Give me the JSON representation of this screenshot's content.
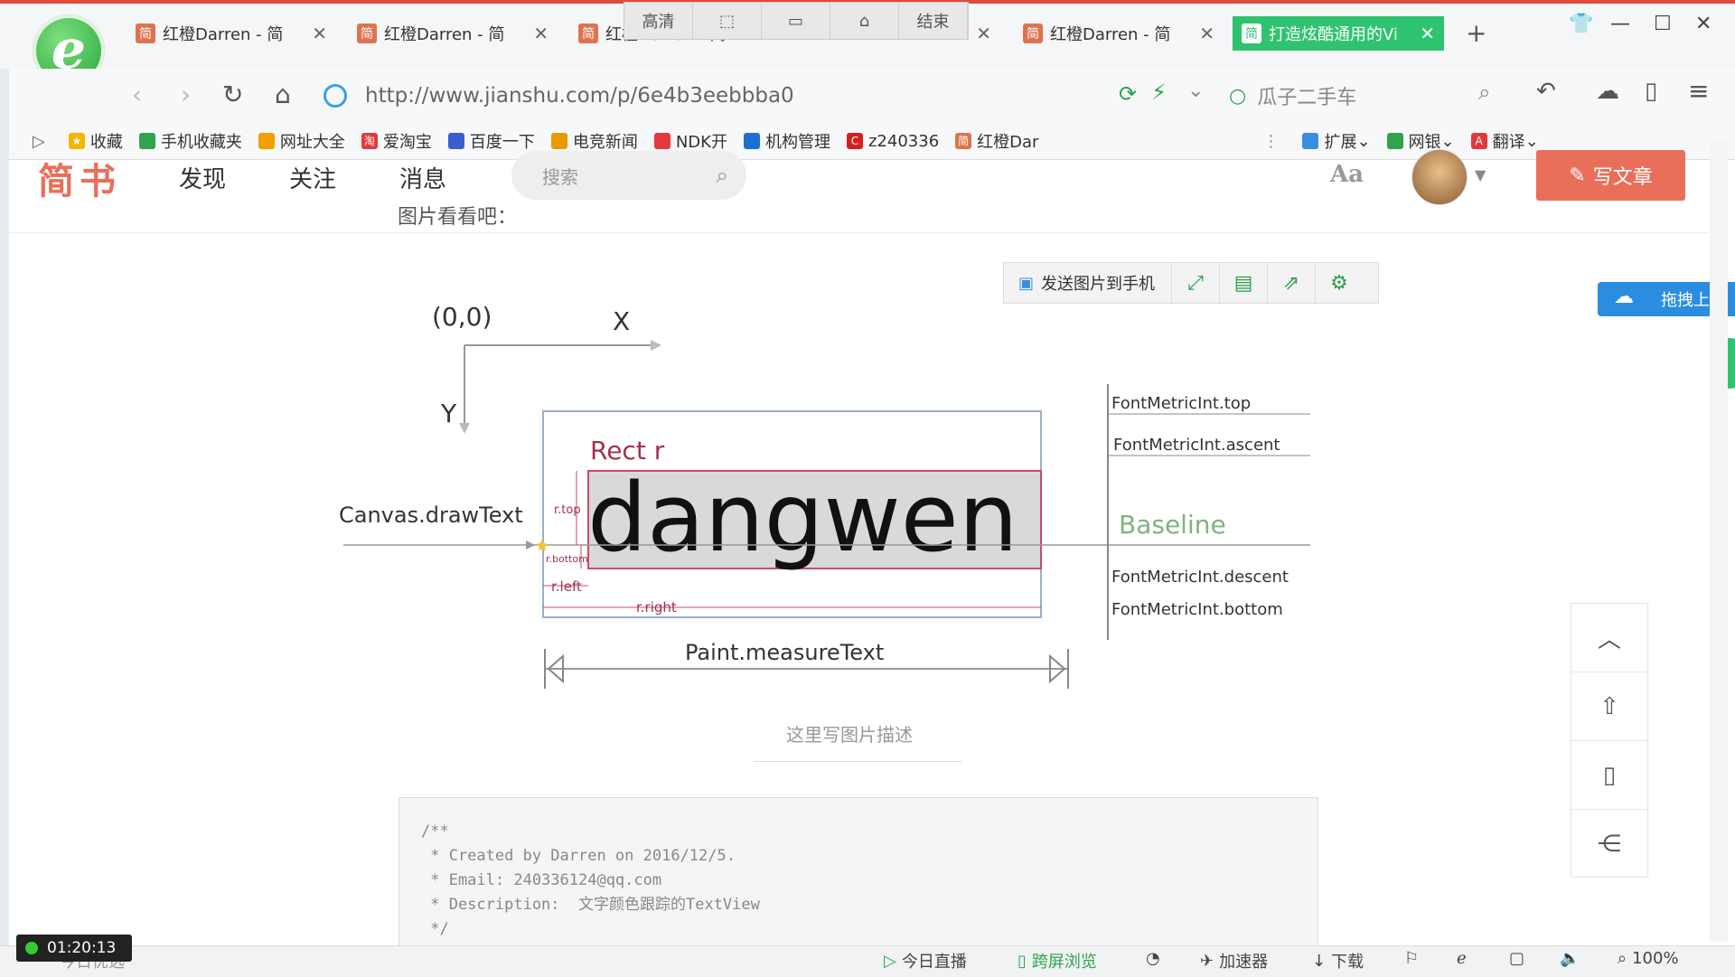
{
  "browser": {
    "tabs": [
      {
        "label": "红橙Darren - 简",
        "active": false
      },
      {
        "label": "红橙Darren - 简",
        "active": false
      },
      {
        "label": "红橙Darren - 简",
        "active": false
      },
      {
        "label": "",
        "active": false
      },
      {
        "label": "红橙Darren - 简",
        "active": false
      },
      {
        "label": "打造炫酷通用的Vi",
        "active": true
      }
    ],
    "tab_favicon": "简",
    "new_tab": "+",
    "recorder_bar": [
      "高清",
      "",
      "",
      "",
      "结束"
    ],
    "url": "http://www.jianshu.com/p/6e4b3eebbba0",
    "search_placeholder": "瓜子二手车",
    "bookmarks": [
      {
        "label": "收藏",
        "color": "#f5b400"
      },
      {
        "label": "手机收藏夹",
        "color": "#2ea44f"
      },
      {
        "label": "网址大全",
        "color": "#f0a000"
      },
      {
        "label": "爱淘宝",
        "color": "#e4393c"
      },
      {
        "label": "百度一下",
        "color": "#3a5fcd"
      },
      {
        "label": "电竞新闻",
        "color": "#e89a00"
      },
      {
        "label": "NDK开",
        "color": "#e4393c"
      },
      {
        "label": "机构管理",
        "color": "#1f6fd1"
      },
      {
        "label": "z240336",
        "color": "#d62020"
      },
      {
        "label": "红橙Dar",
        "color": "#e0734f"
      }
    ],
    "bookmark_right": [
      "扩展",
      "网银",
      "翻译"
    ]
  },
  "site": {
    "brand": "简书",
    "nav": [
      "发现",
      "关注",
      "消息"
    ],
    "search_placeholder": "搜索",
    "aa": "Aa",
    "write_button": "写文章",
    "partial_text": "图片看看吧："
  },
  "image_toolbar": {
    "send_label": "发送图片到手机"
  },
  "cloud_upload": "拖拽上传",
  "diagram": {
    "origin": "(0,0)",
    "x_axis": "X",
    "y_axis": "Y",
    "rect_label": "Rect r",
    "word": "dangwen",
    "draw_text_label": "Canvas.drawText",
    "rtop": "r.top",
    "rbottom": "r.bottom",
    "rleft": "r.left",
    "rright": "r.right",
    "baseline": "Baseline",
    "metrics": {
      "top": "FontMetricInt.top",
      "ascent": "FontMetricInt.ascent",
      "descent": "FontMetricInt.descent",
      "bottom": "FontMetricInt.bottom"
    },
    "measure": "Paint.measureText"
  },
  "caption": "这里写图片描述",
  "code_lines": [
    "/**",
    " * Created by Darren on 2016/12/5.",
    " * Email: 240336124@qq.com",
    " * Description:  文字颜色跟踪的TextView",
    " */"
  ],
  "status": {
    "timer": "01:20:13",
    "live": "今日直播",
    "cross": "跨屏浏览",
    "accel": "加速器",
    "download": "下载",
    "zoom": "100%",
    "left_text": "今日优选"
  },
  "colors": {
    "brand": "#ea6f5a",
    "active_tab": "#2ec36f",
    "text_box_fill": "#d9d9d9",
    "text_box_border": "#c94b6a"
  }
}
